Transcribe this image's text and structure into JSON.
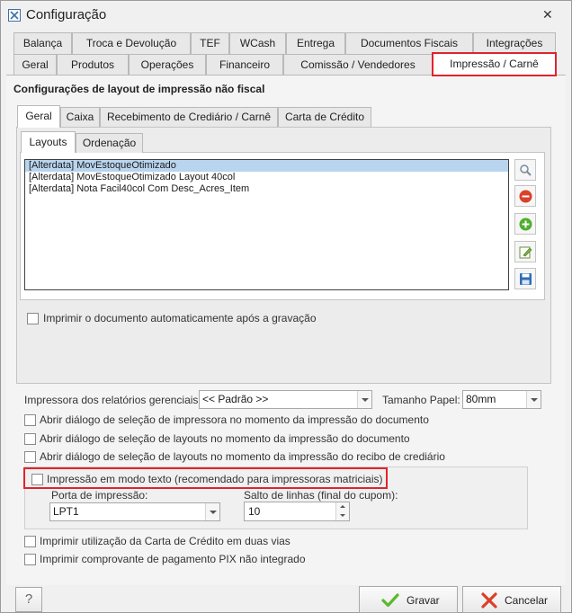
{
  "window": {
    "title": "Configuração",
    "close_glyph": "✕"
  },
  "tabs_row1": [
    "Balança",
    "Troca e Devolução",
    "TEF",
    "WCash",
    "Entrega",
    "Documentos Fiscais",
    "Integrações"
  ],
  "tabs_row2": [
    "Geral",
    "Produtos",
    "Operações",
    "Financeiro",
    "Comissão / Vendedores",
    "Impressão / Carnê"
  ],
  "section_title": "Configurações de layout de impressão não fiscal",
  "subtabs": [
    "Geral",
    "Caixa",
    "Recebimento de Crediário / Carnê",
    "Carta de Crédito"
  ],
  "innertabs": [
    "Layouts",
    "Ordenação"
  ],
  "layouts": [
    "[Alterdata] MovEstoqueOtimizado",
    "[Alterdata] MovEstoqueOtimizado Layout 40col",
    "[Alterdata] Nota Facil40col Com Desc_Acres_Item"
  ],
  "side_buttons": [
    "search-icon",
    "remove-icon",
    "add-icon",
    "edit-icon",
    "save-icon"
  ],
  "auto_print_label": "Imprimir o documento automaticamente após a gravação",
  "printer": {
    "label": "Impressora dos relatórios gerenciais:",
    "value": "<< Padrão >>"
  },
  "paper": {
    "label": "Tamanho Papel:",
    "value": "80mm"
  },
  "options": [
    "Abrir diálogo de seleção de impressora no momento da impressão do documento",
    "Abrir diálogo de seleção de layouts no momento da impressão do documento",
    "Abrir diálogo de seleção de layouts no momento da impressão do recibo de crediário"
  ],
  "text_mode_label": "Impressão em modo texto (recomendado para impressoras matriciais)",
  "port": {
    "label": "Porta de impressão:",
    "value": "LPT1"
  },
  "line_feed": {
    "label": "Salto de linhas (final do cupom):",
    "value": "10"
  },
  "options2": [
    "Imprimir utilização da Carta de Crédito em duas vias",
    "Imprimir comprovante de pagamento PIX não integrado"
  ],
  "footer": {
    "help": "?",
    "save": "Gravar",
    "cancel": "Cancelar"
  },
  "colors": {
    "highlight": "#e0242b",
    "selection": "#b9d4ee",
    "save_check": "#5cb82e",
    "cancel_x": "#d9402a"
  }
}
